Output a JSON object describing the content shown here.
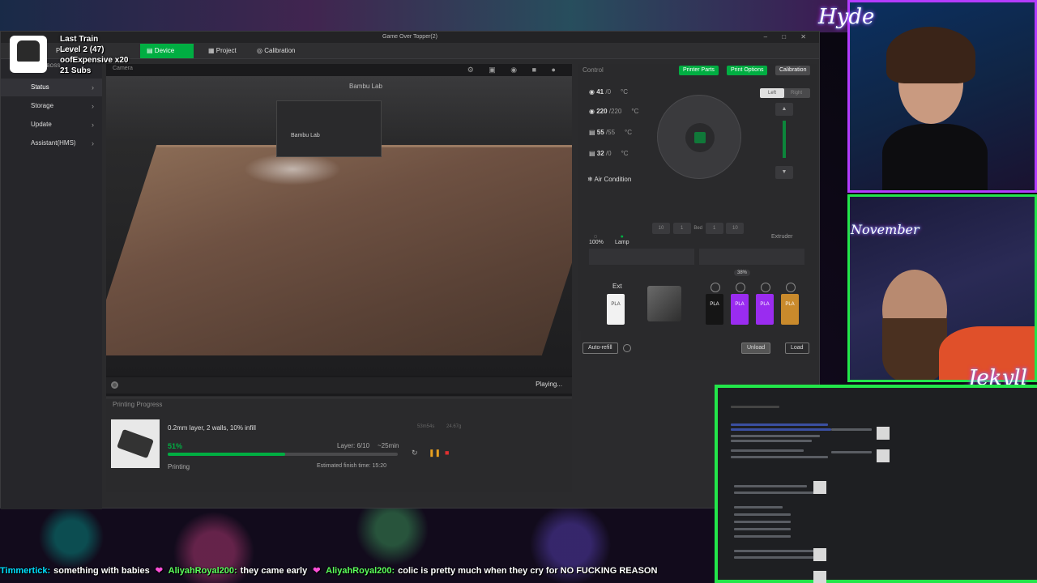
{
  "window_title": "Game Over Topper(2)",
  "topnav": {
    "tabs": [
      {
        "label": "Preview"
      },
      {
        "label": "Device",
        "active": true
      },
      {
        "label": "Project"
      },
      {
        "label": "Calibration"
      }
    ]
  },
  "sidebar": {
    "header_partial": "OBOSS",
    "items": [
      {
        "label": "Status",
        "active": true
      },
      {
        "label": "Storage"
      },
      {
        "label": "Update"
      },
      {
        "label": "Assistant(HMS)"
      }
    ]
  },
  "camera": {
    "label": "Camera",
    "status": "Playing...",
    "brand_top": "Bambu Lab",
    "brand_head": "Bambu Lab"
  },
  "progress": {
    "title": "Printing Progress",
    "job_name": "0.2mm layer, 2 walls, 10% infill",
    "percent_label": "51%",
    "percent_value": 51,
    "layer": "Layer: 6/10",
    "remaining": "~25min",
    "stage": "Printing",
    "estimated_finish": "Estimated finish time: 15:20",
    "faded_weight": "53m54s",
    "faded_time": "24.67g"
  },
  "control": {
    "title": "Control",
    "buttons": [
      "Printer Parts",
      "Print Options",
      "Calibration"
    ],
    "temps": [
      {
        "value": "41",
        "target": "/0",
        "unit": "°C"
      },
      {
        "value": "220",
        "target": "/220",
        "unit": "°C"
      },
      {
        "value": "55",
        "target": "/55",
        "unit": "°C"
      },
      {
        "value": "32",
        "target": "/0",
        "unit": "°C"
      }
    ],
    "air_condition": "Air Condition",
    "fan_label": "100%",
    "lamp_label": "Lamp",
    "z_buttons": [
      "10",
      "1",
      "Bed",
      "1",
      "10"
    ],
    "extruder_toggle": {
      "left": "Left",
      "right": "Right"
    },
    "extruder_label": "Extruder"
  },
  "ams": {
    "ext_label": "Ext",
    "humidity": "38%",
    "spools": [
      {
        "label": "PLA",
        "color": "#ffffff"
      },
      {
        "label": "PLA",
        "color": "#151515"
      },
      {
        "label": "PLA",
        "color": "#9a2cf0"
      },
      {
        "label": "PLA",
        "color": "#9a2cf0"
      },
      {
        "label": "PLA",
        "color": "#c98a2c"
      }
    ],
    "auto_refill": "Auto-refill",
    "unload": "Unload",
    "load": "Load"
  },
  "overlay": {
    "line1": "Last Train",
    "line2": "Level 2  (47)",
    "line3": "oofExpensive x20",
    "line4": "21 Subs"
  },
  "streamers": {
    "top_name": "Hyde",
    "bottom_name": "Jekyll",
    "badge": "November"
  },
  "chat": [
    {
      "user": "Timmertick:",
      "msg": "something with babies"
    },
    {
      "user": "AliyahRoyal200:",
      "msg": "they came early"
    },
    {
      "user": "AliyahRoyal200:",
      "msg": "colic is pretty much when they cry for NO FUCKING REASON"
    }
  ],
  "colors": {
    "accent": "#00ae42",
    "frame_green": "#22e64a",
    "frame_purple": "#b33cff"
  }
}
